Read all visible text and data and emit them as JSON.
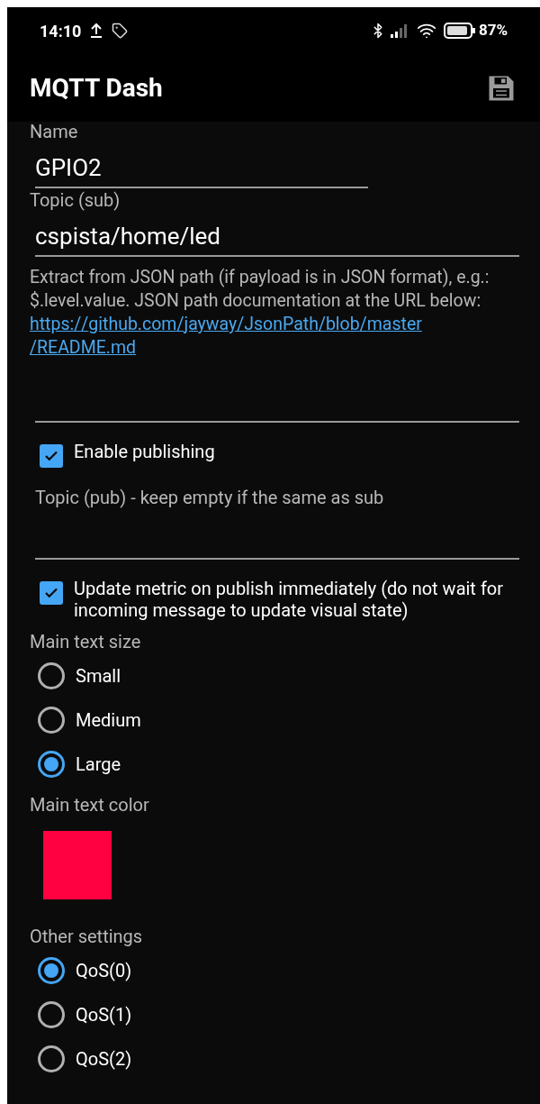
{
  "status_bar": {
    "time": "14:10",
    "battery": "87%"
  },
  "app_bar": {
    "title": "MQTT Dash"
  },
  "form": [
    {
      "kind": "field",
      "label": "Name",
      "value": "GPIO2",
      "short": true
    },
    {
      "kind": "field",
      "label": "Topic (sub)",
      "value": "cspista/home/led",
      "short": false
    },
    {
      "kind": "help",
      "text": "Extract from JSON path (if payload is in JSON format), e.g.: $.level.value. JSON path documentation at the URL below:",
      "link": "https://github.com/jayway/JsonPath/blob/master/README.md"
    },
    {
      "kind": "empty_field"
    },
    {
      "kind": "checkbox",
      "label": "Enable publishing",
      "checked": true
    },
    {
      "kind": "hint_field",
      "placeholder": "Topic (pub) - keep empty if the same as sub"
    },
    {
      "kind": "checkbox",
      "label": "Update metric on publish immediately (do not wait for incoming message to update visual state)",
      "checked": true
    },
    {
      "kind": "radio_group",
      "label": "Main text size",
      "options": [
        {
          "label": "Small",
          "selected": false
        },
        {
          "label": "Medium",
          "selected": false
        },
        {
          "label": "Large",
          "selected": true
        }
      ]
    },
    {
      "kind": "color",
      "label": "Main text color",
      "color": "#ff0040"
    },
    {
      "kind": "radio_group",
      "label": "Other settings",
      "options": [
        {
          "label": "QoS(0)",
          "selected": true
        },
        {
          "label": "QoS(1)",
          "selected": false
        },
        {
          "label": "QoS(2)",
          "selected": false
        }
      ]
    }
  ]
}
